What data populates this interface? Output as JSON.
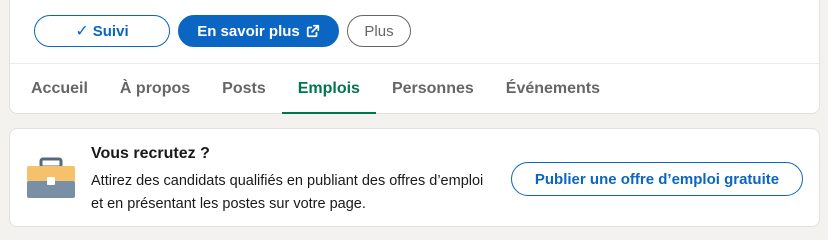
{
  "actions": {
    "follow_label": "Suivi",
    "learn_more_label": "En savoir plus",
    "more_label": "Plus"
  },
  "tabs": [
    {
      "label": "Accueil",
      "active": false
    },
    {
      "label": "À propos",
      "active": false
    },
    {
      "label": "Posts",
      "active": false
    },
    {
      "label": "Emplois",
      "active": true
    },
    {
      "label": "Personnes",
      "active": false
    },
    {
      "label": "Événements",
      "active": false
    }
  ],
  "recruit": {
    "title": "Vous recrutez ?",
    "description": "Attirez des candidats qualifiés en publiant des offres d’emploi et en présentant les postes sur votre page.",
    "button_label": "Publier une offre d’emploi gratuite",
    "icon": "briefcase-icon"
  },
  "colors": {
    "brand_blue": "#0a66c2",
    "active_tab_green": "#01754f",
    "muted_text": "#666666",
    "page_background": "#f4f2ee"
  }
}
